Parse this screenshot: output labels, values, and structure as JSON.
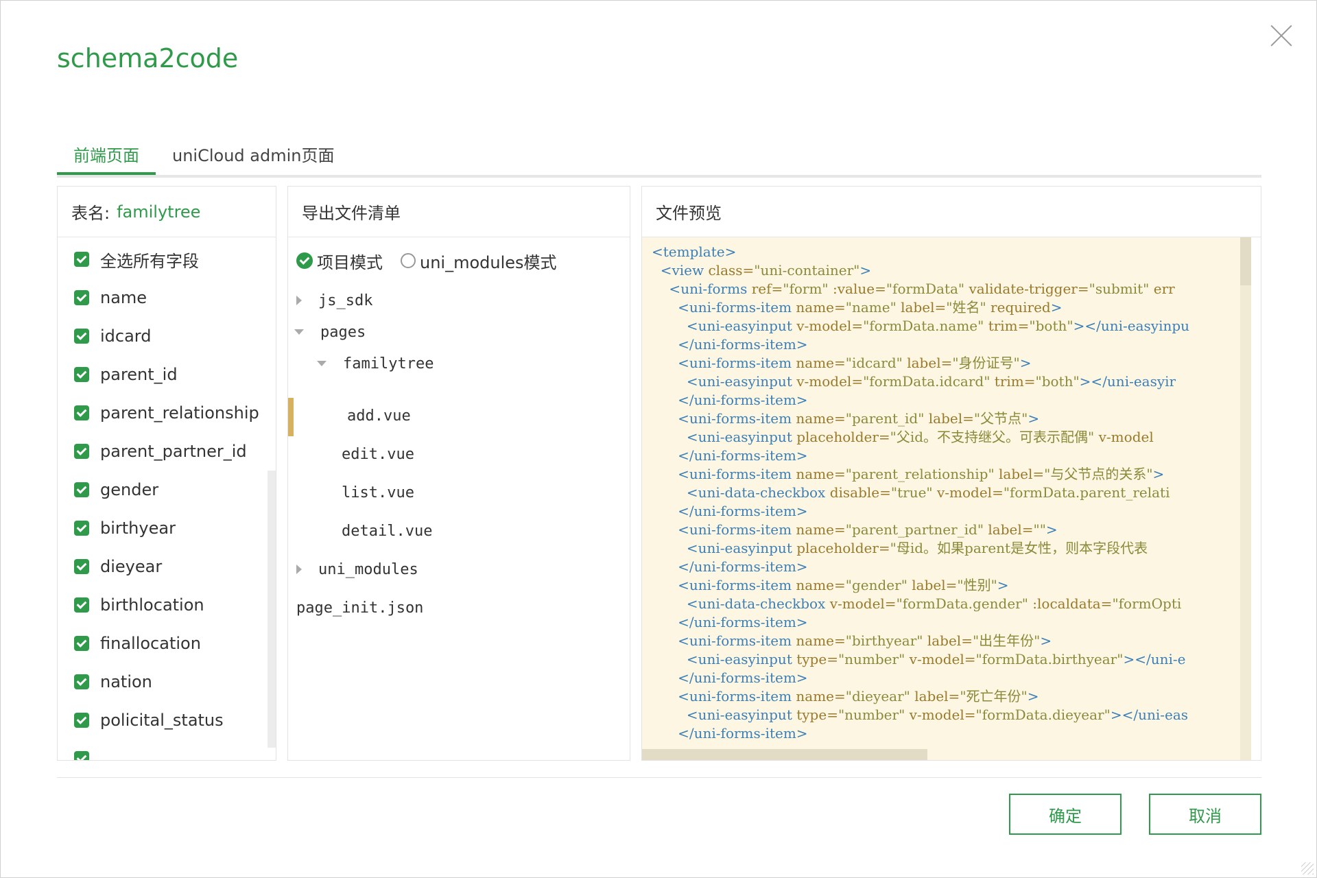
{
  "dialog": {
    "title": "schema2code"
  },
  "tabs": [
    {
      "label": "前端页面"
    },
    {
      "label": "uniCloud admin页面"
    }
  ],
  "left": {
    "label": "表名:",
    "table_name": "familytree",
    "select_all": "全选所有字段",
    "fields": [
      "name",
      "idcard",
      "parent_id",
      "parent_relationship",
      "parent_partner_id",
      "gender",
      "birthyear",
      "dieyear",
      "birthlocation",
      "finallocation",
      "nation",
      "policital_status"
    ]
  },
  "middle": {
    "header": "导出文件清单",
    "mode_project": "项目模式",
    "mode_uni_modules": "uni_modules模式",
    "tree": [
      "js_sdk",
      "pages",
      "familytree",
      "add.vue",
      "edit.vue",
      "list.vue",
      "detail.vue",
      "uni_modules",
      "page_init.json"
    ]
  },
  "right": {
    "header": "文件预览",
    "code": [
      [
        [
          "t",
          "<template>"
        ]
      ],
      [
        [
          "t",
          "  <view "
        ],
        [
          "a",
          "class="
        ],
        [
          "s",
          "\"uni-container\""
        ],
        [
          "t",
          ">"
        ]
      ],
      [
        [
          "t",
          "    <uni-forms "
        ],
        [
          "a",
          "ref="
        ],
        [
          "s",
          "\"form\" "
        ],
        [
          "a",
          ":value="
        ],
        [
          "s",
          "\"formData\" "
        ],
        [
          "a",
          "validate-trigger="
        ],
        [
          "s",
          "\"submit\" "
        ],
        [
          "a",
          "err"
        ]
      ],
      [
        [
          "t",
          "      <uni-forms-item "
        ],
        [
          "a",
          "name="
        ],
        [
          "s",
          "\"name\" "
        ],
        [
          "a",
          "label="
        ],
        [
          "s",
          "\"姓名\" "
        ],
        [
          "a",
          "required"
        ],
        [
          "t",
          ">"
        ]
      ],
      [
        [
          "t",
          "        <uni-easyinput "
        ],
        [
          "a",
          "v-model="
        ],
        [
          "s",
          "\"formData.name\" "
        ],
        [
          "a",
          "trim="
        ],
        [
          "s",
          "\"both\""
        ],
        [
          "t",
          "></uni-easyinpu"
        ]
      ],
      [
        [
          "t",
          "      </uni-forms-item>"
        ]
      ],
      [
        [
          "t",
          "      <uni-forms-item "
        ],
        [
          "a",
          "name="
        ],
        [
          "s",
          "\"idcard\" "
        ],
        [
          "a",
          "label="
        ],
        [
          "s",
          "\"身份证号\""
        ],
        [
          "t",
          ">"
        ]
      ],
      [
        [
          "t",
          "        <uni-easyinput "
        ],
        [
          "a",
          "v-model="
        ],
        [
          "s",
          "\"formData.idcard\" "
        ],
        [
          "a",
          "trim="
        ],
        [
          "s",
          "\"both\""
        ],
        [
          "t",
          "></uni-easyir"
        ]
      ],
      [
        [
          "t",
          "      </uni-forms-item>"
        ]
      ],
      [
        [
          "t",
          "      <uni-forms-item "
        ],
        [
          "a",
          "name="
        ],
        [
          "s",
          "\"parent_id\" "
        ],
        [
          "a",
          "label="
        ],
        [
          "s",
          "\"父节点\""
        ],
        [
          "t",
          ">"
        ]
      ],
      [
        [
          "t",
          "        <uni-easyinput "
        ],
        [
          "a",
          "placeholder="
        ],
        [
          "s",
          "\"父id。不支持继父。可表示配偶\" "
        ],
        [
          "a",
          "v-model"
        ]
      ],
      [
        [
          "t",
          "      </uni-forms-item>"
        ]
      ],
      [
        [
          "t",
          "      <uni-forms-item "
        ],
        [
          "a",
          "name="
        ],
        [
          "s",
          "\"parent_relationship\" "
        ],
        [
          "a",
          "label="
        ],
        [
          "s",
          "\"与父节点的关系\""
        ],
        [
          "t",
          ">"
        ]
      ],
      [
        [
          "t",
          "        <uni-data-checkbox "
        ],
        [
          "a",
          "disable="
        ],
        [
          "s",
          "\"true\" "
        ],
        [
          "a",
          "v-model="
        ],
        [
          "s",
          "\"formData.parent_relati"
        ]
      ],
      [
        [
          "t",
          "      </uni-forms-item>"
        ]
      ],
      [
        [
          "t",
          "      <uni-forms-item "
        ],
        [
          "a",
          "name="
        ],
        [
          "s",
          "\"parent_partner_id\" "
        ],
        [
          "a",
          "label="
        ],
        [
          "s",
          "\"\""
        ],
        [
          "t",
          ">"
        ]
      ],
      [
        [
          "t",
          "        <uni-easyinput "
        ],
        [
          "a",
          "placeholder="
        ],
        [
          "s",
          "\"母id。如果parent是女性，则本字段代表"
        ]
      ],
      [
        [
          "t",
          "      </uni-forms-item>"
        ]
      ],
      [
        [
          "t",
          "      <uni-forms-item "
        ],
        [
          "a",
          "name="
        ],
        [
          "s",
          "\"gender\" "
        ],
        [
          "a",
          "label="
        ],
        [
          "s",
          "\"性别\""
        ],
        [
          "t",
          ">"
        ]
      ],
      [
        [
          "t",
          "        <uni-data-checkbox "
        ],
        [
          "a",
          "v-model="
        ],
        [
          "s",
          "\"formData.gender\" "
        ],
        [
          "a",
          ":localdata="
        ],
        [
          "s",
          "\"formOpti"
        ]
      ],
      [
        [
          "t",
          "      </uni-forms-item>"
        ]
      ],
      [
        [
          "t",
          "      <uni-forms-item "
        ],
        [
          "a",
          "name="
        ],
        [
          "s",
          "\"birthyear\" "
        ],
        [
          "a",
          "label="
        ],
        [
          "s",
          "\"出生年份\""
        ],
        [
          "t",
          ">"
        ]
      ],
      [
        [
          "t",
          "        <uni-easyinput "
        ],
        [
          "a",
          "type="
        ],
        [
          "s",
          "\"number\" "
        ],
        [
          "a",
          "v-model="
        ],
        [
          "s",
          "\"formData.birthyear\""
        ],
        [
          "t",
          "></uni-e"
        ]
      ],
      [
        [
          "t",
          "      </uni-forms-item>"
        ]
      ],
      [
        [
          "t",
          "      <uni-forms-item "
        ],
        [
          "a",
          "name="
        ],
        [
          "s",
          "\"dieyear\" "
        ],
        [
          "a",
          "label="
        ],
        [
          "s",
          "\"死亡年份\""
        ],
        [
          "t",
          ">"
        ]
      ],
      [
        [
          "t",
          "        <uni-easyinput "
        ],
        [
          "a",
          "type="
        ],
        [
          "s",
          "\"number\" "
        ],
        [
          "a",
          "v-model="
        ],
        [
          "s",
          "\"formData.dieyear\""
        ],
        [
          "t",
          "></uni-eas"
        ]
      ],
      [
        [
          "t",
          "      </uni-forms-item>"
        ]
      ]
    ]
  },
  "buttons": {
    "confirm": "确定",
    "cancel": "取消"
  },
  "colors": {
    "accent": "#2f9a4a",
    "code_bg": "#fdf6e3",
    "selection": "#d6b160"
  }
}
